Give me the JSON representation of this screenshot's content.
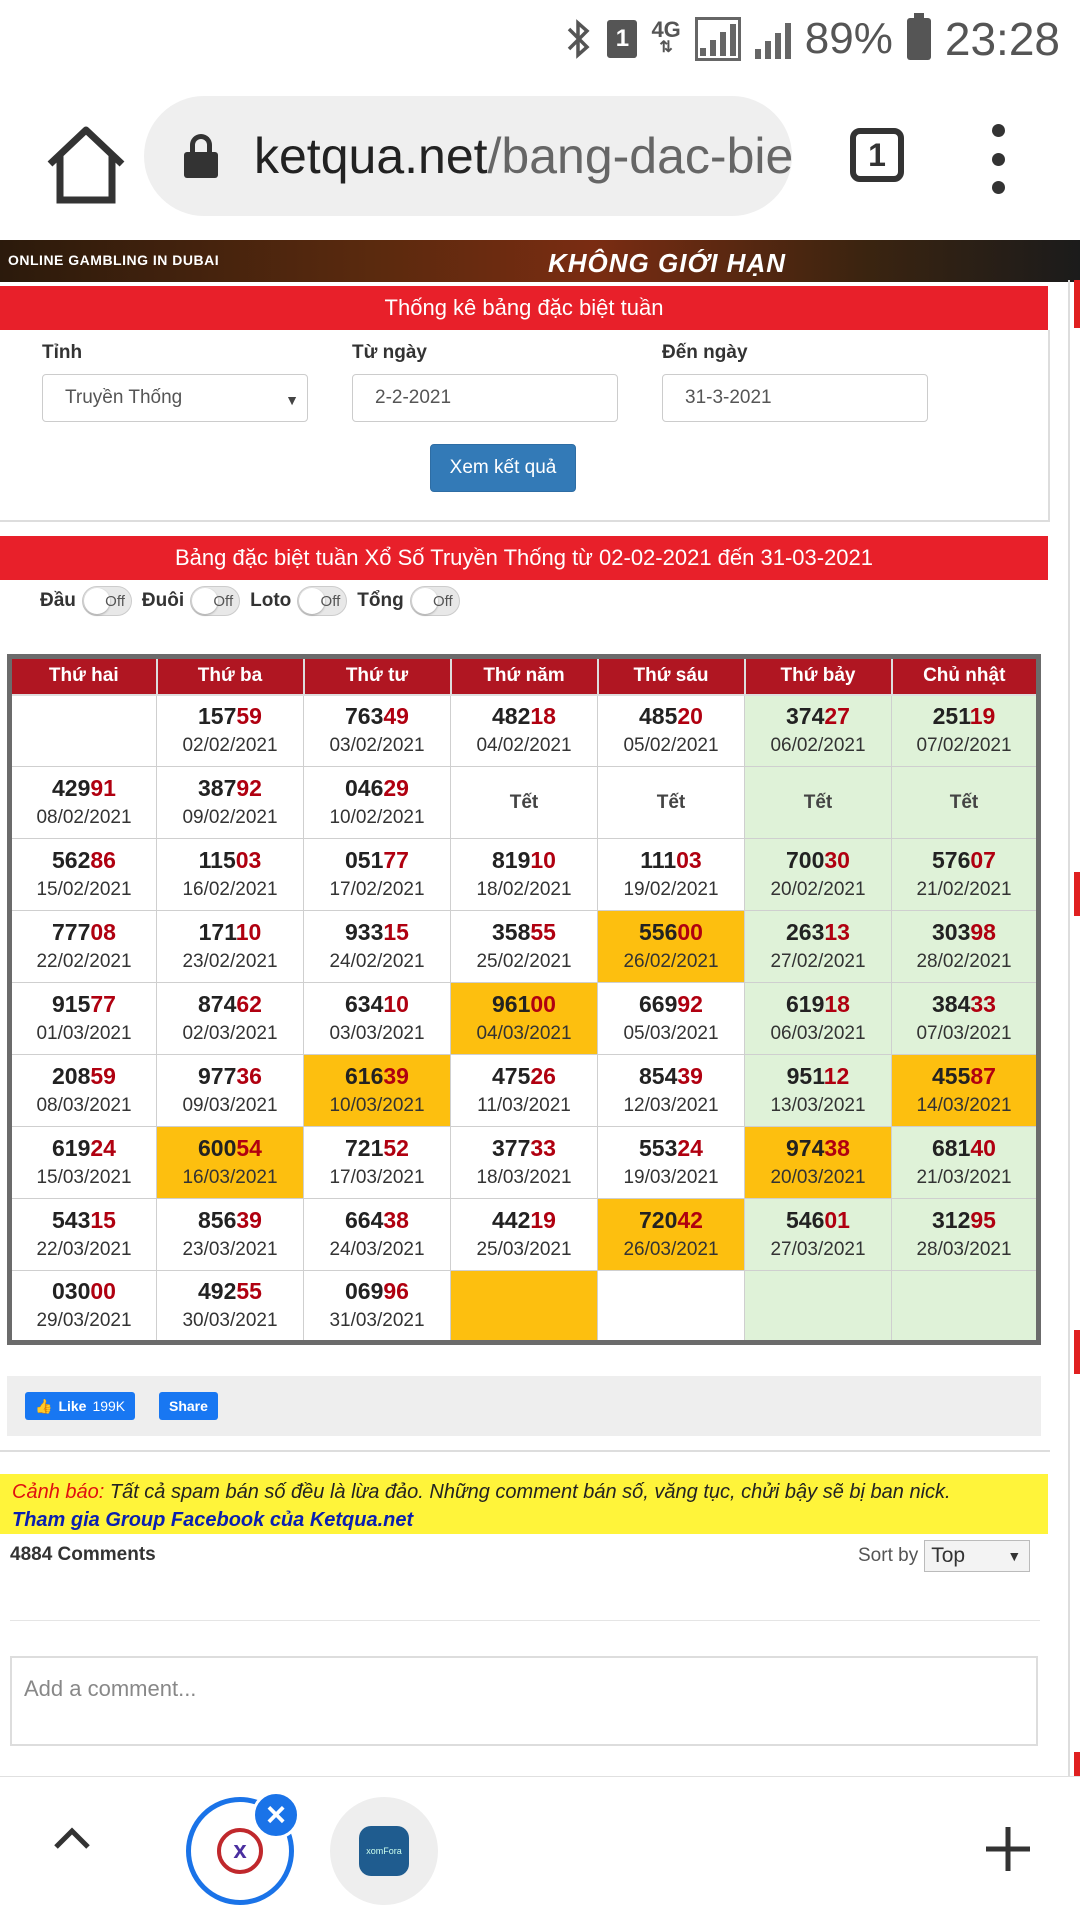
{
  "status_bar": {
    "network": "4G",
    "sim": "1",
    "battery": "89%",
    "time": "23:28"
  },
  "browser": {
    "url_host": "ketqua.net",
    "url_path": "/bang-dac-bie",
    "tab_count": "1"
  },
  "banner": {
    "left_text": "ONLINE GAMBLING IN DUBAI",
    "right_text": "KHÔNG GIỚI HẠN"
  },
  "filter": {
    "title": "Thống kê bảng đặc biệt tuần",
    "province_label": "Tỉnh",
    "province_value": "Truyền Thống",
    "from_label": "Từ ngày",
    "from_value": "2-2-2021",
    "to_label": "Đến ngày",
    "to_value": "31-3-2021",
    "submit_label": "Xem kết quả"
  },
  "results": {
    "title": "Bảng đặc biệt tuần Xổ Số Truyền Thống từ 02-02-2021 đến 31-03-2021",
    "toggles": [
      {
        "label": "Đầu",
        "state": "Off"
      },
      {
        "label": "Đuôi",
        "state": "Off"
      },
      {
        "label": "Loto",
        "state": "Off"
      },
      {
        "label": "Tổng",
        "state": "Off"
      }
    ],
    "headers": [
      "Thứ hai",
      "Thứ ba",
      "Thứ tư",
      "Thứ năm",
      "Thứ sáu",
      "Thứ bảy",
      "Chủ nhật"
    ],
    "rows": [
      [
        null,
        {
          "h": "157",
          "t": "59",
          "d": "02/02/2021"
        },
        {
          "h": "763",
          "t": "49",
          "d": "03/02/2021"
        },
        {
          "h": "482",
          "t": "18",
          "d": "04/02/2021"
        },
        {
          "h": "485",
          "t": "20",
          "d": "05/02/2021"
        },
        {
          "h": "374",
          "t": "27",
          "d": "06/02/2021"
        },
        {
          "h": "251",
          "t": "19",
          "d": "07/02/2021"
        }
      ],
      [
        {
          "h": "429",
          "t": "91",
          "d": "08/02/2021"
        },
        {
          "h": "387",
          "t": "92",
          "d": "09/02/2021"
        },
        {
          "h": "046",
          "t": "29",
          "d": "10/02/2021"
        },
        {
          "tet": "Tết"
        },
        {
          "tet": "Tết"
        },
        {
          "tet": "Tết"
        },
        {
          "tet": "Tết"
        }
      ],
      [
        {
          "h": "562",
          "t": "86",
          "d": "15/02/2021"
        },
        {
          "h": "115",
          "t": "03",
          "d": "16/02/2021"
        },
        {
          "h": "051",
          "t": "77",
          "d": "17/02/2021"
        },
        {
          "h": "819",
          "t": "10",
          "d": "18/02/2021"
        },
        {
          "h": "111",
          "t": "03",
          "d": "19/02/2021"
        },
        {
          "h": "700",
          "t": "30",
          "d": "20/02/2021"
        },
        {
          "h": "576",
          "t": "07",
          "d": "21/02/2021"
        }
      ],
      [
        {
          "h": "777",
          "t": "08",
          "d": "22/02/2021"
        },
        {
          "h": "171",
          "t": "10",
          "d": "23/02/2021"
        },
        {
          "h": "933",
          "t": "15",
          "d": "24/02/2021"
        },
        {
          "h": "358",
          "t": "55",
          "d": "25/02/2021"
        },
        {
          "h": "556",
          "t": "00",
          "d": "26/02/2021",
          "hl": true
        },
        {
          "h": "263",
          "t": "13",
          "d": "27/02/2021"
        },
        {
          "h": "303",
          "t": "98",
          "d": "28/02/2021"
        }
      ],
      [
        {
          "h": "915",
          "t": "77",
          "d": "01/03/2021"
        },
        {
          "h": "874",
          "t": "62",
          "d": "02/03/2021"
        },
        {
          "h": "634",
          "t": "10",
          "d": "03/03/2021"
        },
        {
          "h": "961",
          "t": "00",
          "d": "04/03/2021",
          "hl": true
        },
        {
          "h": "669",
          "t": "92",
          "d": "05/03/2021"
        },
        {
          "h": "619",
          "t": "18",
          "d": "06/03/2021"
        },
        {
          "h": "384",
          "t": "33",
          "d": "07/03/2021"
        }
      ],
      [
        {
          "h": "208",
          "t": "59",
          "d": "08/03/2021"
        },
        {
          "h": "977",
          "t": "36",
          "d": "09/03/2021"
        },
        {
          "h": "616",
          "t": "39",
          "d": "10/03/2021",
          "hl": true
        },
        {
          "h": "475",
          "t": "26",
          "d": "11/03/2021"
        },
        {
          "h": "854",
          "t": "39",
          "d": "12/03/2021"
        },
        {
          "h": "951",
          "t": "12",
          "d": "13/03/2021"
        },
        {
          "h": "455",
          "t": "87",
          "d": "14/03/2021",
          "hl": true
        }
      ],
      [
        {
          "h": "619",
          "t": "24",
          "d": "15/03/2021"
        },
        {
          "h": "600",
          "t": "54",
          "d": "16/03/2021",
          "hl": true
        },
        {
          "h": "721",
          "t": "52",
          "d": "17/03/2021"
        },
        {
          "h": "377",
          "t": "33",
          "d": "18/03/2021"
        },
        {
          "h": "553",
          "t": "24",
          "d": "19/03/2021"
        },
        {
          "h": "974",
          "t": "38",
          "d": "20/03/2021",
          "hl": true
        },
        {
          "h": "681",
          "t": "40",
          "d": "21/03/2021"
        }
      ],
      [
        {
          "h": "543",
          "t": "15",
          "d": "22/03/2021"
        },
        {
          "h": "856",
          "t": "39",
          "d": "23/03/2021"
        },
        {
          "h": "664",
          "t": "38",
          "d": "24/03/2021"
        },
        {
          "h": "442",
          "t": "19",
          "d": "25/03/2021"
        },
        {
          "h": "720",
          "t": "42",
          "d": "26/03/2021",
          "hl": true
        },
        {
          "h": "546",
          "t": "01",
          "d": "27/03/2021"
        },
        {
          "h": "312",
          "t": "95",
          "d": "28/03/2021"
        }
      ],
      [
        {
          "h": "030",
          "t": "00",
          "d": "29/03/2021"
        },
        {
          "h": "492",
          "t": "55",
          "d": "30/03/2021"
        },
        {
          "h": "069",
          "t": "96",
          "d": "31/03/2021"
        },
        {
          "empty": true,
          "hl": true
        },
        null,
        null,
        null
      ]
    ]
  },
  "social": {
    "like_label": "Like",
    "like_count": "199K",
    "share_label": "Share"
  },
  "warning": {
    "label": "Cảnh báo:",
    "message": " Tất cả spam bán số đều là lừa đảo. Những comment bán số, văng tục, chửi bậy sẽ bị ban nick.",
    "group_link": "Tham gia Group Facebook của Ketqua.net"
  },
  "comments": {
    "count": "4884 Comments",
    "sort_label": "Sort by",
    "sort_value": "Top",
    "placeholder": "Add a comment..."
  },
  "bottom_bar": {
    "tab2_label": "xomFora"
  }
}
